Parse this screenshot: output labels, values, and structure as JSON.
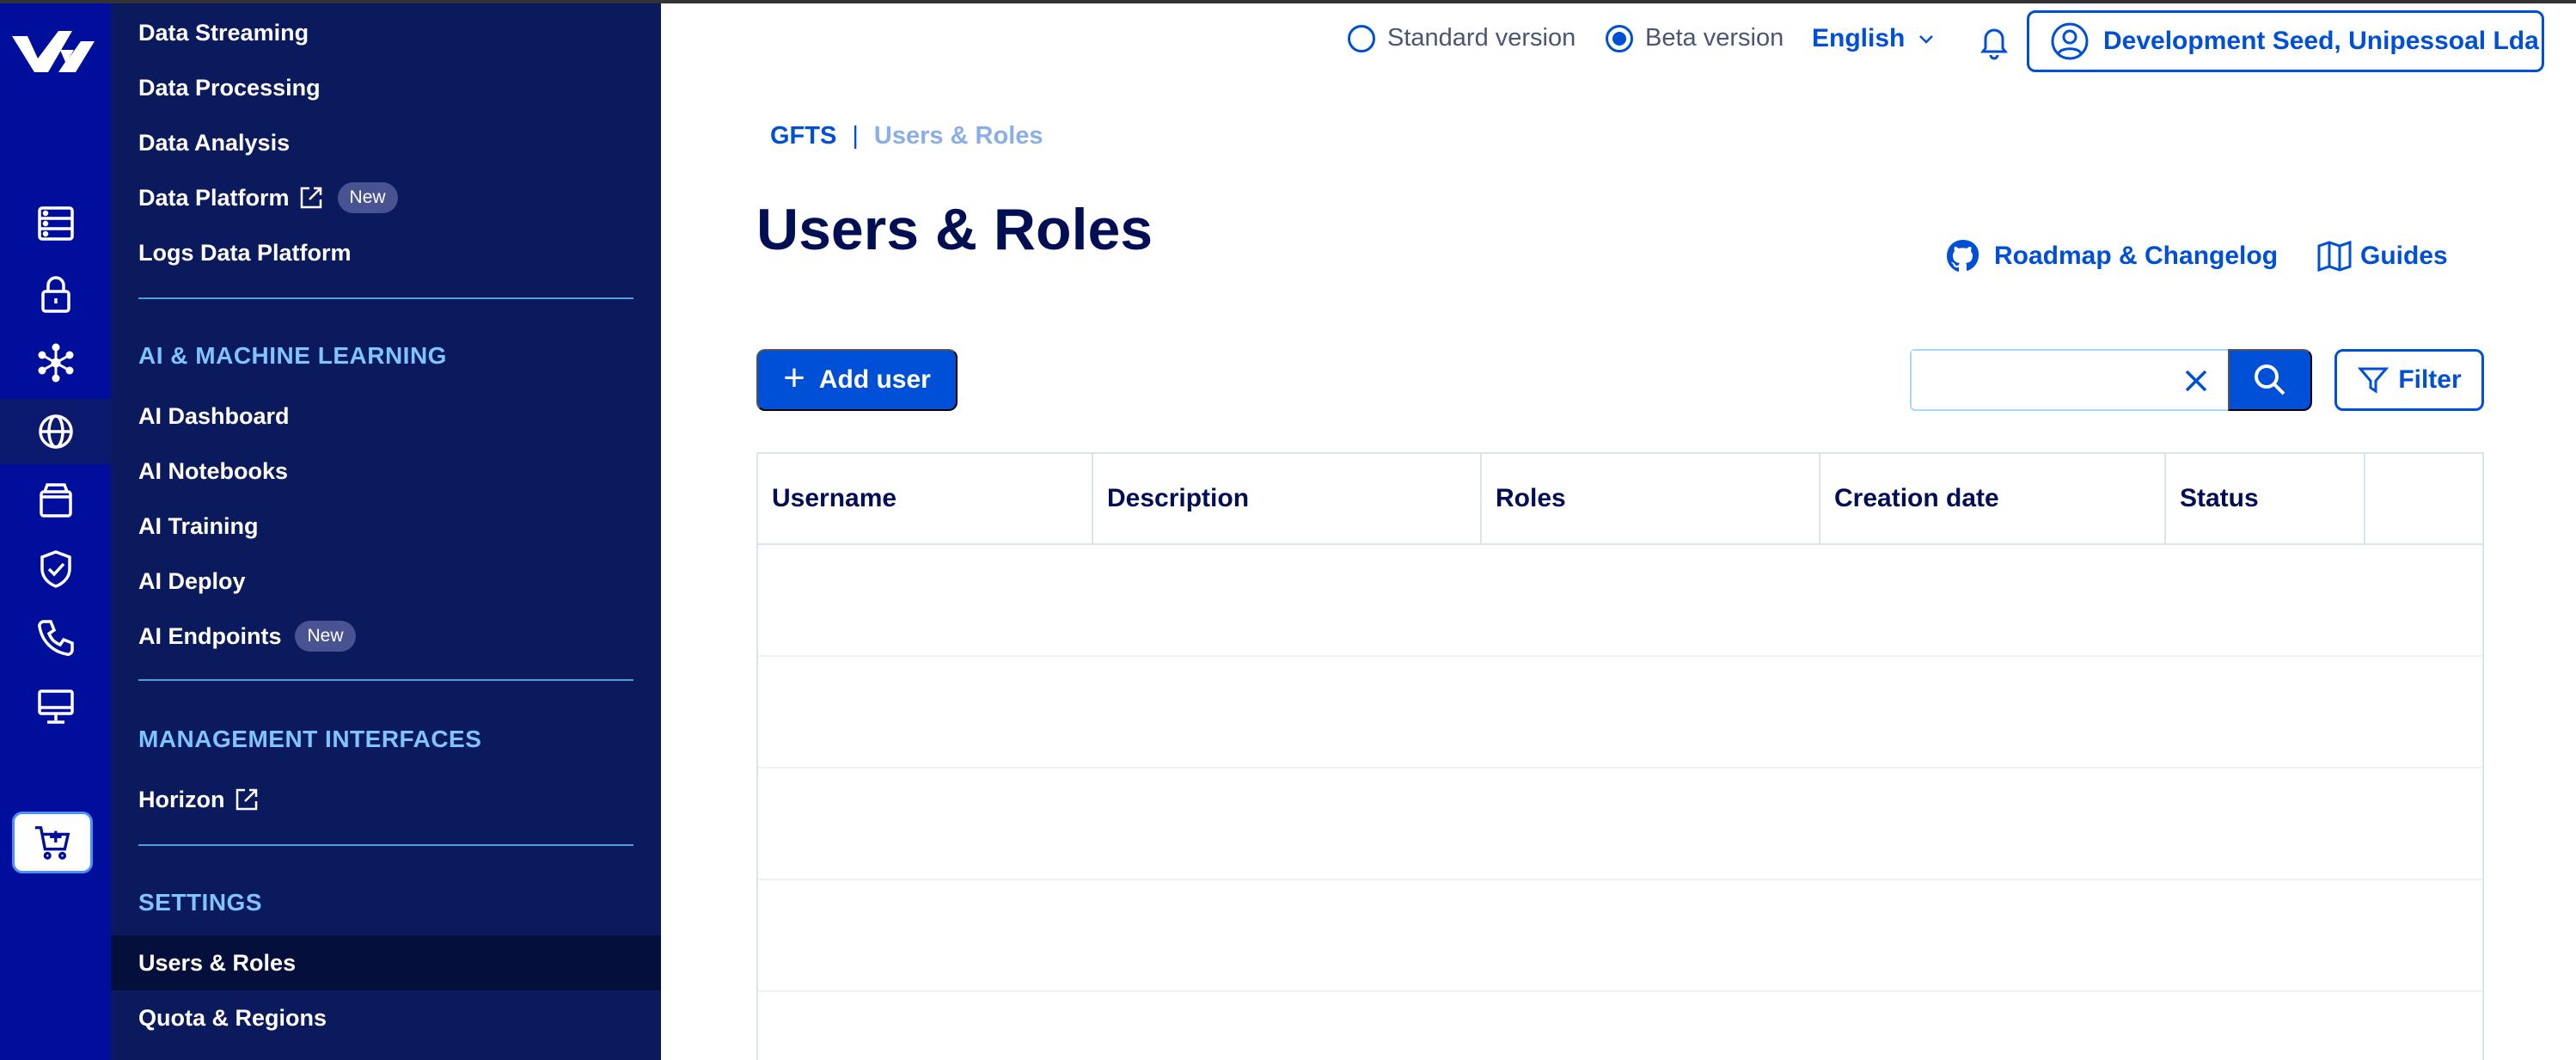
{
  "rail": {
    "icons": [
      "logo-icon",
      "server-icon",
      "lock-icon",
      "network-icon",
      "globe-icon",
      "storage-box-icon",
      "shield-check-icon",
      "phone-icon",
      "monitor-icon",
      "cart-plus-icon"
    ]
  },
  "menu": {
    "top_items": [
      {
        "label": "Data Streaming"
      },
      {
        "label": "Data Processing"
      },
      {
        "label": "Data Analysis"
      },
      {
        "label": "Data Platform",
        "external": true,
        "badge": "New"
      },
      {
        "label": "Logs Data Platform"
      }
    ],
    "ai_section": {
      "title": "AI & MACHINE LEARNING",
      "items": [
        {
          "label": "AI Dashboard"
        },
        {
          "label": "AI Notebooks"
        },
        {
          "label": "AI Training"
        },
        {
          "label": "AI Deploy"
        },
        {
          "label": "AI Endpoints",
          "badge": "New"
        }
      ]
    },
    "management_section": {
      "title": "MANAGEMENT INTERFACES",
      "items": [
        {
          "label": "Horizon",
          "external": true
        }
      ]
    },
    "settings_section": {
      "title": "SETTINGS",
      "items": [
        {
          "label": "Users & Roles",
          "active": true
        },
        {
          "label": "Quota & Regions"
        }
      ]
    }
  },
  "header": {
    "standard_version": "Standard version",
    "beta_version": "Beta version",
    "selected_version": "Beta version",
    "language": "English",
    "account": "Development Seed, Unipessoal Lda"
  },
  "breadcrumb": {
    "root": "GFTS",
    "separator": "|",
    "current": "Users & Roles"
  },
  "page": {
    "title": "Users & Roles",
    "roadmap_link": "Roadmap & Changelog",
    "guides_link": "Guides"
  },
  "toolbar": {
    "add_user": "Add user",
    "search_value": "",
    "filter": "Filter"
  },
  "table": {
    "columns": [
      "Username",
      "Description",
      "Roles",
      "Creation date",
      "Status",
      ""
    ],
    "rows": []
  },
  "colors": {
    "rail_bg": "#000e9c",
    "menu_bg": "#0b1a5c",
    "primary": "#0050d7",
    "section_title": "#7fc4ff",
    "title_text": "#000e54"
  }
}
